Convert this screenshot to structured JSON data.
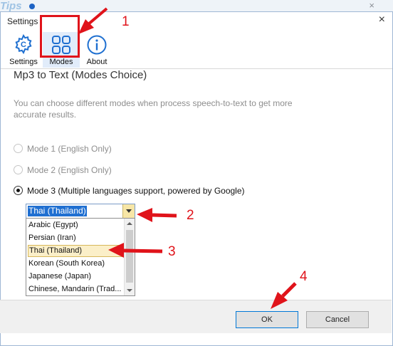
{
  "background_window": {
    "logo_text": "Tips",
    "close_glyph": "×"
  },
  "dialog": {
    "title": "Settings",
    "close_glyph": "×"
  },
  "toolbar": {
    "tabs": [
      {
        "label": "Settings",
        "icon": "gear-icon"
      },
      {
        "label": "Modes",
        "icon": "grid-icon"
      },
      {
        "label": "About",
        "icon": "info-icon"
      }
    ]
  },
  "content": {
    "heading": "Mp3 to Text (Modes Choice)",
    "description": "You can choose different modes when process speech-to-text to get more accurate results.",
    "modes": [
      {
        "label": "Mode 1 (English Only)",
        "checked": false,
        "enabled": false
      },
      {
        "label": "Mode 2 (English Only)",
        "checked": false,
        "enabled": false
      },
      {
        "label": "Mode 3 (Multiple languages support, powered by Google)",
        "checked": true,
        "enabled": true
      }
    ],
    "language_select": {
      "selected": "Thai (Thailand)",
      "options": [
        "Arabic (Egypt)",
        "Persian (Iran)",
        "Thai (Thailand)",
        "Korean (South Korea)",
        "Japanese (Japan)",
        "Chinese, Mandarin (Trad..."
      ]
    }
  },
  "footer": {
    "ok_label": "OK",
    "cancel_label": "Cancel"
  },
  "annotations": {
    "markers": [
      "1",
      "2",
      "3",
      "4"
    ],
    "color": "#e0131a"
  },
  "colors": {
    "accent": "#1f6fd1",
    "highlight": "#e0131a",
    "selected_item": "#fbefc8"
  }
}
